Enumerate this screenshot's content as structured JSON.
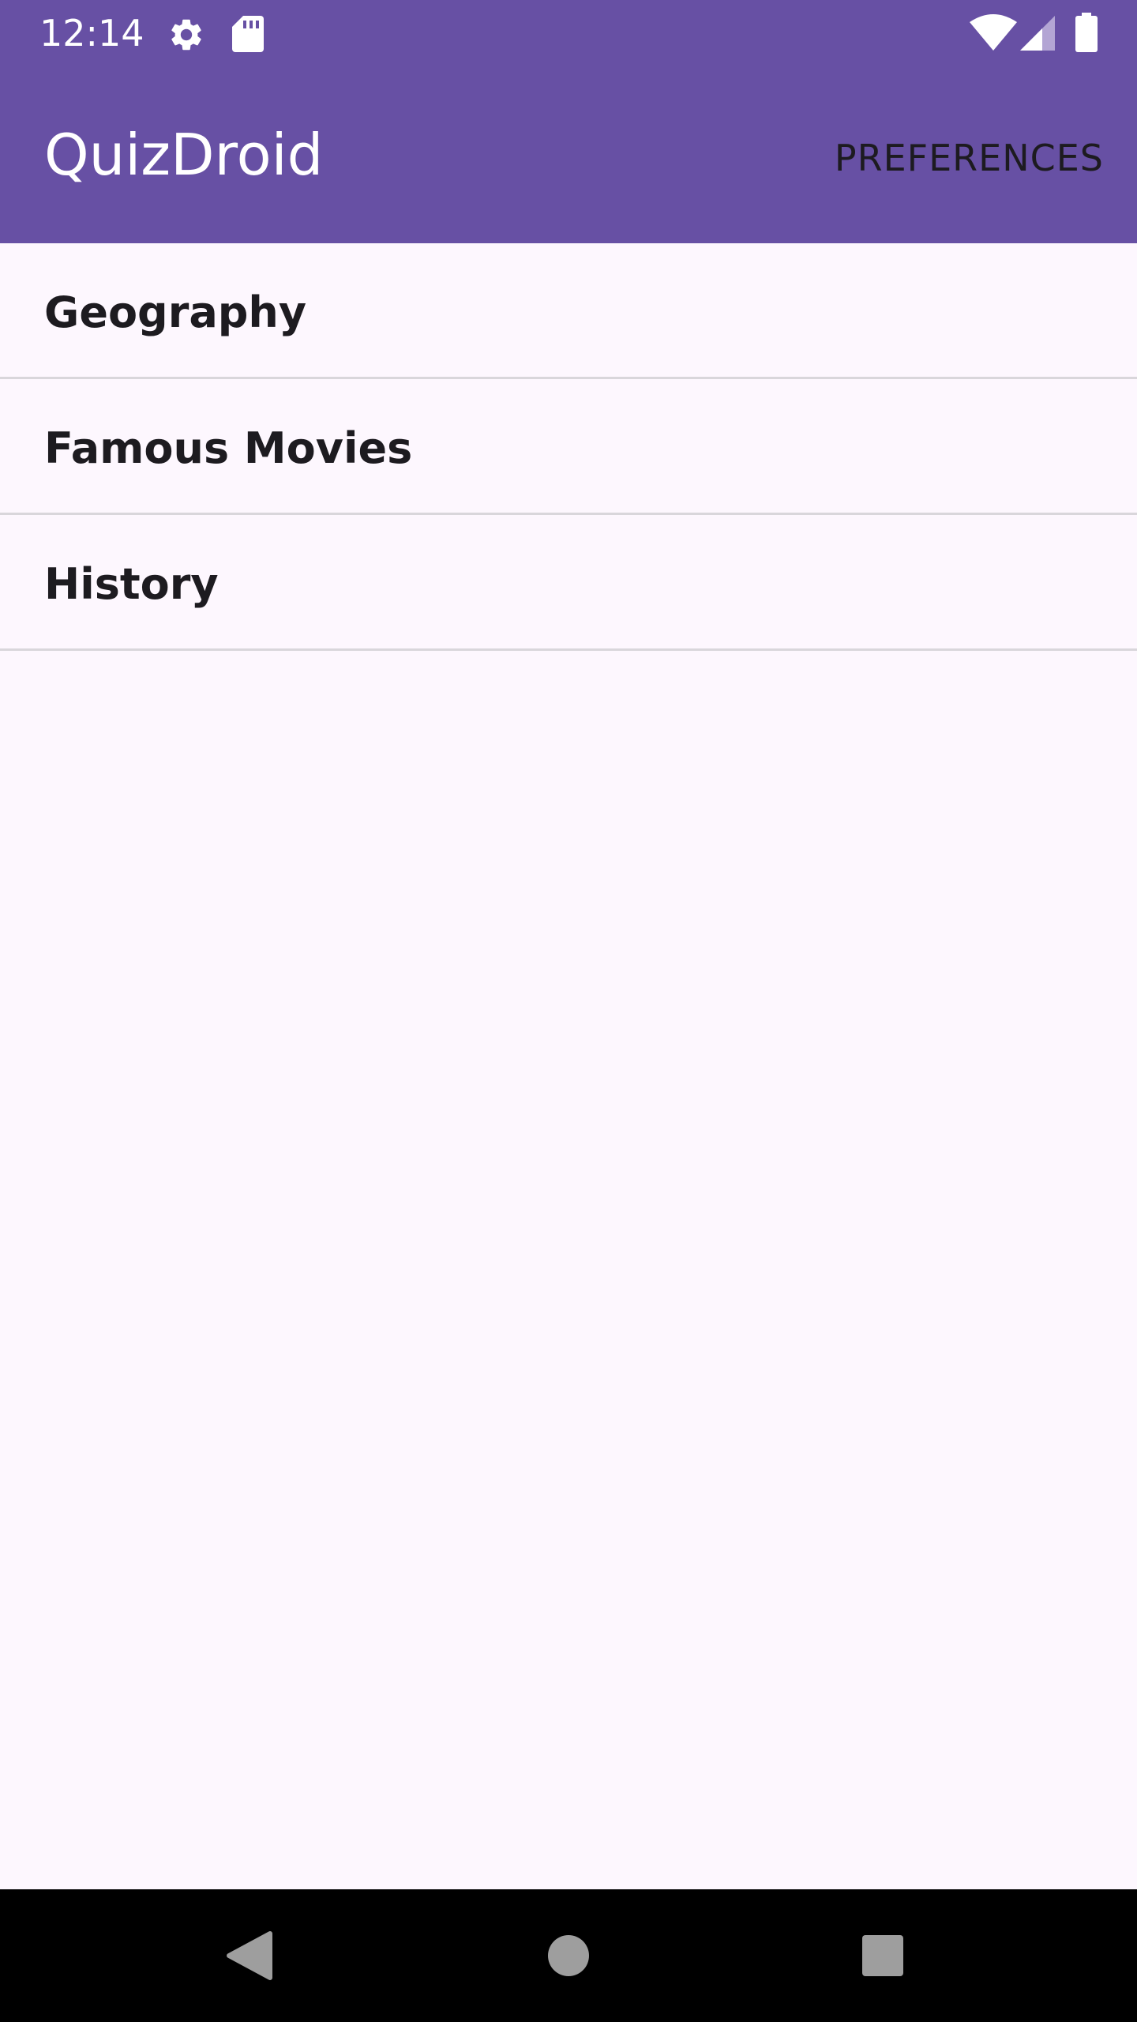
{
  "status_bar": {
    "time": "12:14",
    "icons": [
      "gear-icon",
      "sd-card-icon",
      "wifi-icon",
      "cell-signal-icon",
      "battery-icon"
    ]
  },
  "app_bar": {
    "title": "QuizDroid",
    "preferences_label": "PREFERENCES"
  },
  "topics": [
    {
      "label": "Geography"
    },
    {
      "label": "Famous Movies"
    },
    {
      "label": "History"
    }
  ],
  "nav_bar": {
    "icons": [
      "back-icon",
      "home-icon",
      "recents-icon"
    ]
  },
  "colors": {
    "primary": "#6750a4",
    "background": "#fdf7fe",
    "on_surface": "#1d1b20",
    "divider": "#d9d6db"
  }
}
